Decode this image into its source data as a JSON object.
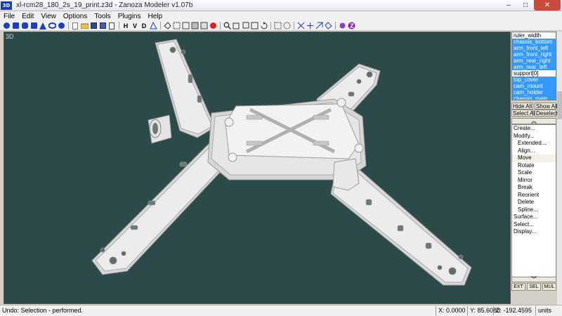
{
  "window": {
    "title": "xl-rcm28_180_2s_19_print.z3d - Zanoza Modeler v1.07b",
    "app_icon": "3D",
    "minimize": "–",
    "maximize": "□",
    "close": "✕"
  },
  "menu": {
    "items": [
      "File",
      "Edit",
      "View",
      "Options",
      "Tools",
      "Plugins",
      "Help"
    ]
  },
  "toolbar": {
    "view_h": "H",
    "view_v": "V",
    "view_d": "D",
    "icons": [
      "sphere-icon",
      "cube-icon",
      "cylinder-icon",
      "cone-icon",
      "torus-icon",
      "new-file-icon",
      "save-icon",
      "render-icon",
      "zoom-icon",
      "rotate-icon",
      "select-icon",
      "z-icon"
    ]
  },
  "viewport": {
    "label": "3D",
    "background": "#2c4a47",
    "model_color": "#ececec"
  },
  "object_list": {
    "items": [
      {
        "label": "ruler_width",
        "selected": false
      },
      {
        "label": "chassis_bottom",
        "selected": true
      },
      {
        "label": "arm_front_left",
        "selected": true
      },
      {
        "label": "arm_front_right",
        "selected": true
      },
      {
        "label": "arm_rear_right",
        "selected": true
      },
      {
        "label": "arm_rear_left",
        "selected": true
      },
      {
        "label": "support[0]",
        "selected": false
      },
      {
        "label": "top_cover",
        "selected": true
      },
      {
        "label": "cam_mount",
        "selected": true
      },
      {
        "label": "cam_holder",
        "selected": true
      },
      {
        "label": "chassis_main",
        "selected": true
      }
    ]
  },
  "panel": {
    "hide_all": "Hide All",
    "show_all": "Show All",
    "select_all": "Select All",
    "deselect": "Deselect",
    "collapse": "︽",
    "expand": "︾",
    "commands": {
      "create": "Create...",
      "modify": "Modify...",
      "extended": "Extended...",
      "align": "Align...",
      "move": "Move",
      "rotate": "Rotate",
      "scale": "Scale",
      "mirror": "Mirror",
      "break": "Break",
      "reorient": "Reorient",
      "delete": "Delete",
      "spline": "Spline...",
      "surface": "Surface...",
      "select": "Select...",
      "display": "Display..."
    },
    "modes": {
      "ext": "EXT",
      "sel": "SEL",
      "mul": "MUL"
    }
  },
  "status": {
    "message": "Undo: Selection - performed.",
    "x": "X: 0.0000",
    "y": "Y: 85.6080",
    "z": "Z: -192.4595",
    "units": "units"
  }
}
